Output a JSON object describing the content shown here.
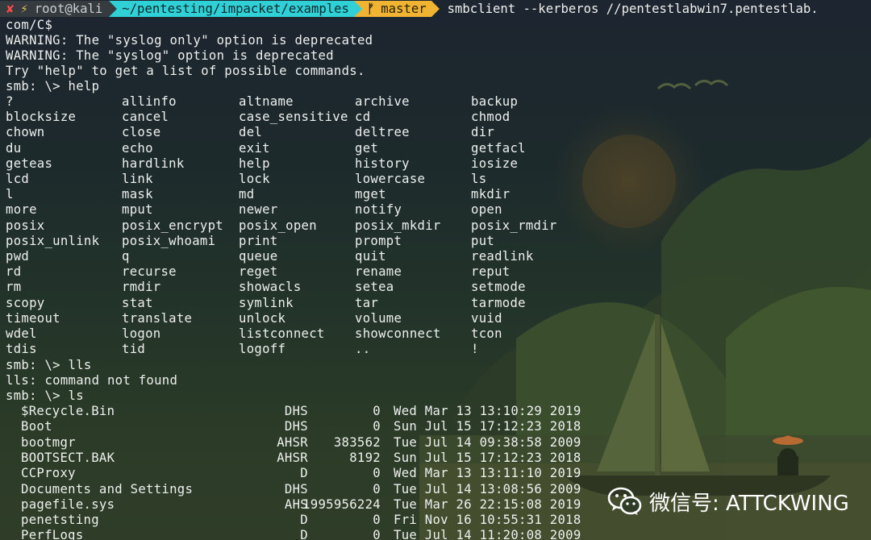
{
  "prompt": {
    "x_mark": "✘",
    "bolt": "⚡",
    "user_host": "root@kali",
    "path": "~/pentesting/impacket/examples",
    "branch_icon": "ᚠ",
    "branch": "master",
    "command": "smbclient --kerberos //pentestlabwin7.pentestlab."
  },
  "lines_top": [
    "com/C$",
    "WARNING: The \"syslog only\" option is deprecated",
    "WARNING: The \"syslog\" option is deprecated",
    "Try \"help\" to get a list of possible commands.",
    "smb: \\> help"
  ],
  "help_commands": [
    [
      "?",
      "allinfo",
      "altname",
      "archive",
      "backup"
    ],
    [
      "blocksize",
      "cancel",
      "case_sensitive",
      "cd",
      "chmod"
    ],
    [
      "chown",
      "close",
      "del",
      "deltree",
      "dir"
    ],
    [
      "du",
      "echo",
      "exit",
      "get",
      "getfacl"
    ],
    [
      "geteas",
      "hardlink",
      "help",
      "history",
      "iosize"
    ],
    [
      "lcd",
      "link",
      "lock",
      "lowercase",
      "ls"
    ],
    [
      "l",
      "mask",
      "md",
      "mget",
      "mkdir"
    ],
    [
      "more",
      "mput",
      "newer",
      "notify",
      "open"
    ],
    [
      "posix",
      "posix_encrypt",
      "posix_open",
      "posix_mkdir",
      "posix_rmdir"
    ],
    [
      "posix_unlink",
      "posix_whoami",
      "print",
      "prompt",
      "put"
    ],
    [
      "pwd",
      "q",
      "queue",
      "quit",
      "readlink"
    ],
    [
      "rd",
      "recurse",
      "reget",
      "rename",
      "reput"
    ],
    [
      "rm",
      "rmdir",
      "showacls",
      "setea",
      "setmode"
    ],
    [
      "scopy",
      "stat",
      "symlink",
      "tar",
      "tarmode"
    ],
    [
      "timeout",
      "translate",
      "unlock",
      "volume",
      "vuid"
    ],
    [
      "wdel",
      "logon",
      "listconnect",
      "showconnect",
      "tcon"
    ],
    [
      "tdis",
      "tid",
      "logoff",
      "..",
      "!"
    ]
  ],
  "lines_mid": [
    "smb: \\> lls",
    "lls: command not found",
    "smb: \\> ls"
  ],
  "ls_entries": [
    {
      "name": "$Recycle.Bin",
      "attr": "DHS",
      "size": "0",
      "date": "Wed Mar 13 13:10:29 2019"
    },
    {
      "name": "Boot",
      "attr": "DHS",
      "size": "0",
      "date": "Sun Jul 15 17:12:23 2018"
    },
    {
      "name": "bootmgr",
      "attr": "AHSR",
      "size": "383562",
      "date": "Tue Jul 14 09:38:58 2009"
    },
    {
      "name": "BOOTSECT.BAK",
      "attr": "AHSR",
      "size": "8192",
      "date": "Sun Jul 15 17:12:23 2018"
    },
    {
      "name": "CCProxy",
      "attr": "D",
      "size": "0",
      "date": "Wed Mar 13 13:11:10 2019"
    },
    {
      "name": "Documents and Settings",
      "attr": "DHS",
      "size": "0",
      "date": "Tue Jul 14 13:08:56 2009"
    },
    {
      "name": "pagefile.sys",
      "attr": "AHS",
      "size": "1995956224",
      "date": "Tue Mar 26 22:15:08 2019"
    },
    {
      "name": "penetsting",
      "attr": "D",
      "size": "0",
      "date": "Fri Nov 16 10:55:31 2018"
    },
    {
      "name": "PerfLogs",
      "attr": "D",
      "size": "0",
      "date": "Tue Jul 14 11:20:08 2009"
    }
  ],
  "watermark": {
    "text": "微信号: ATTCKWING",
    "icon": "wechat-icon"
  },
  "colors": {
    "host_segment": "#363b3f",
    "path_segment": "#2fd0d6",
    "git_segment": "#f0b432",
    "error_mark": "#ff4a4a",
    "text": "#eef0ee"
  }
}
